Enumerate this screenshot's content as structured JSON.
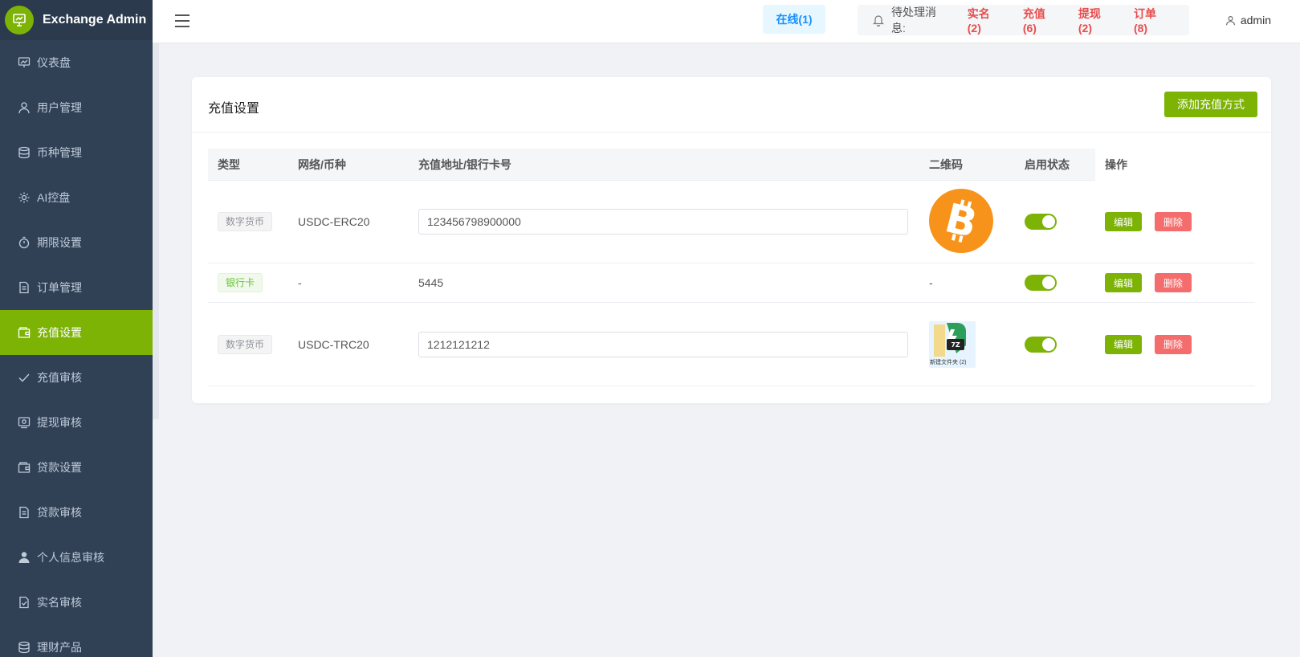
{
  "app": {
    "title": "Exchange Admin"
  },
  "sidebar": {
    "items": [
      {
        "label": "仪表盘",
        "icon": "dashboard-icon"
      },
      {
        "label": "用户管理",
        "icon": "user-icon"
      },
      {
        "label": "币种管理",
        "icon": "database-icon"
      },
      {
        "label": "AI控盘",
        "icon": "gear-icon"
      },
      {
        "label": "期限设置",
        "icon": "timer-icon"
      },
      {
        "label": "订单管理",
        "icon": "document-icon"
      },
      {
        "label": "充值设置",
        "icon": "wallet-icon",
        "active": true
      },
      {
        "label": "充值审核",
        "icon": "check-icon"
      },
      {
        "label": "提现审核",
        "icon": "withdraw-icon"
      },
      {
        "label": "贷款设置",
        "icon": "wallet-icon"
      },
      {
        "label": "贷款审核",
        "icon": "document-icon"
      },
      {
        "label": "个人信息审核",
        "icon": "person-icon"
      },
      {
        "label": "实名审核",
        "icon": "document-check-icon"
      },
      {
        "label": "理财产品",
        "icon": "database-icon"
      }
    ]
  },
  "header": {
    "online": "在线(1)",
    "pending_label": "待处理消息:",
    "pending": [
      "实名(2)",
      "充值(6)",
      "提现(2)",
      "订单(8)"
    ],
    "user": "admin"
  },
  "card": {
    "title": "充值设置",
    "add_button": "添加充值方式"
  },
  "table": {
    "columns": [
      "类型",
      "网络/币种",
      "充值地址/银行卡号",
      "二维码",
      "启用状态",
      "操作"
    ],
    "rows": [
      {
        "type": "数字货币",
        "network": "USDC-ERC20",
        "address": "123456798900000",
        "qr": "bitcoin-logo",
        "enabled": true,
        "edit": "编辑",
        "delete": "删除"
      },
      {
        "type": "银行卡",
        "network": "-",
        "address": "5445",
        "qr": "-",
        "enabled": true,
        "edit": "编辑",
        "delete": "删除"
      },
      {
        "type": "数字货币",
        "network": "USDC-TRC20",
        "address": "1212121212",
        "qr": "folder-thumbnail",
        "qr_caption": "新建文件夹 (2)",
        "qr_badge": "7Z",
        "enabled": true,
        "edit": "编辑",
        "delete": "删除"
      }
    ]
  },
  "colors": {
    "accent": "#7cb305",
    "sidebar": "#304156",
    "danger": "#f56c6c",
    "link_red": "#e84c4c",
    "online_blue": "#1890ff"
  }
}
